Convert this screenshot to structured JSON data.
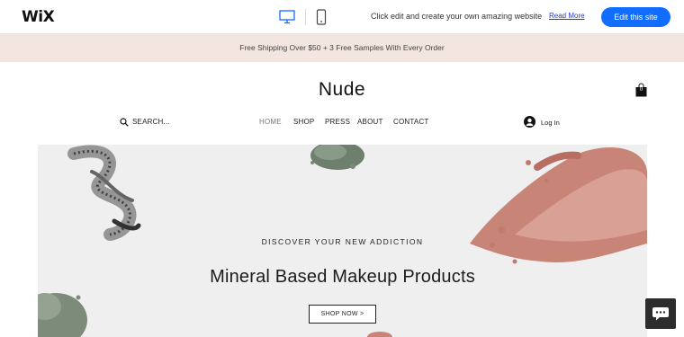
{
  "wix_bar": {
    "logo": "WiX",
    "promo_text": "Click edit and create your own amazing website",
    "read_more": "Read More",
    "edit_button": "Edit this site",
    "icons": [
      "desktop-icon",
      "mobile-icon"
    ]
  },
  "announcement": "Free Shipping Over $50 + 3 Free Samples With Every Order",
  "header": {
    "brand": "Nude",
    "cart_count": "0",
    "search_label": "SEARCH...",
    "nav": [
      "HOME",
      "SHOP",
      "PRESS",
      "ABOUT",
      "CONTACT"
    ],
    "active_nav": "HOME",
    "login_label": "Log In"
  },
  "hero": {
    "eyebrow": "DISCOVER YOUR NEW ADDICTION",
    "title": "Mineral Based Makeup Products",
    "button": "SHOP NOW >"
  },
  "colors": {
    "accent": "#116dff",
    "announcement_bg": "#f3e6e0",
    "hero_bg": "#efefef",
    "blush": "#c98478"
  }
}
